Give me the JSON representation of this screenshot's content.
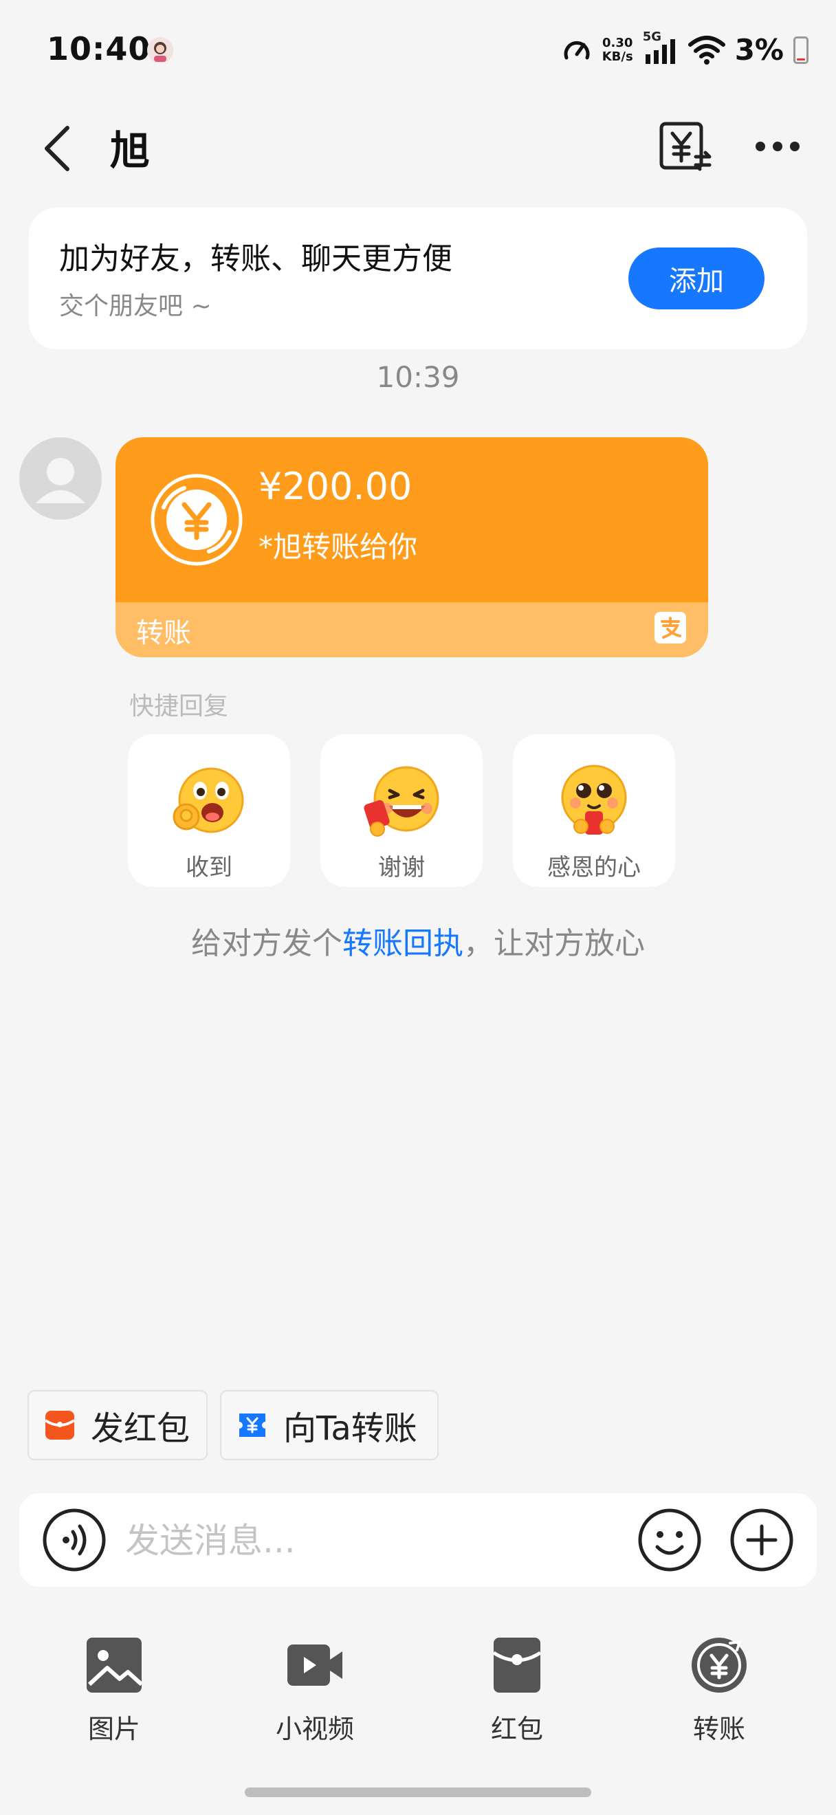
{
  "status_bar": {
    "time": "10:40",
    "net_speed_value": "0.30",
    "net_speed_unit": "KB/s",
    "network": "5G",
    "battery": "3%"
  },
  "header": {
    "title": "旭"
  },
  "friend_card": {
    "title": "加为好友，转账、聊天更方便",
    "subtitle": "交个朋友吧 ~",
    "add_label": "添加"
  },
  "chat": {
    "timestamp": "10:39",
    "transfer": {
      "amount": "¥200.00",
      "description": "*旭转账给你",
      "label": "转账",
      "card_color": "#ff9c1b"
    },
    "quick_reply": {
      "title": "快捷回复",
      "items": [
        {
          "label": "收到",
          "icon": "ok-hand-emoji-icon"
        },
        {
          "label": "谢谢",
          "icon": "laughing-red-envelope-emoji-icon"
        },
        {
          "label": "感恩的心",
          "icon": "grateful-emoji-icon"
        }
      ]
    },
    "hint": {
      "before": "给对方发个",
      "link": "转账回执",
      "after": "，让对方放心"
    }
  },
  "shortcuts": [
    {
      "label": "发红包",
      "icon": "red-envelope-icon"
    },
    {
      "label": "向Ta转账",
      "icon": "transfer-ticket-icon"
    }
  ],
  "input": {
    "placeholder": "发送消息..."
  },
  "toolbar": [
    {
      "label": "图片",
      "icon": "image-icon"
    },
    {
      "label": "小视频",
      "icon": "video-icon"
    },
    {
      "label": "红包",
      "icon": "red-packet-icon"
    },
    {
      "label": "转账",
      "icon": "transfer-icon"
    }
  ],
  "colors": {
    "accent": "#1677ff",
    "transfer_orange": "#ff9c1b",
    "link": "#1677ff"
  }
}
